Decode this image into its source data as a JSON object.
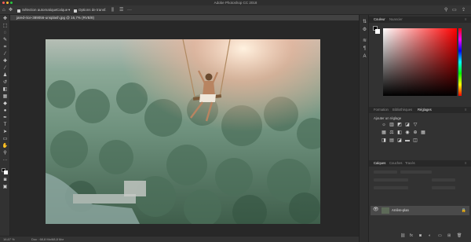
{
  "window": {
    "title": "Adobe Photoshop CC 2018"
  },
  "options_bar": {
    "auto_select_label": "Sélection automatique",
    "auto_select_value": "Calque",
    "transform_label": "Options de transf."
  },
  "document": {
    "tab_title": "jared-rice-389056-unsplash.jpg @ 16,7% (RVB/8)"
  },
  "status_bar": {
    "zoom": "16,67 %",
    "doc_info": "Doc : 68,8 Mo/68,8 Mo"
  },
  "panels": {
    "color_tabs": [
      "Couleur",
      "Nuancier"
    ],
    "adjust_tabs": [
      "Formation",
      "Bibliothèques",
      "Réglages"
    ],
    "adjust_title": "Ajouter un réglage",
    "layers_tabs": [
      "Calques",
      "Couches",
      "Tracés"
    ],
    "layer_name": "Arrière-plan"
  },
  "icons": {
    "move": "move-tool-icon",
    "eye": "eye-icon",
    "lock": "lock-icon"
  },
  "colors": {
    "accent": "#ff0000",
    "panel_bg": "#323232",
    "canvas_bg": "#282828"
  }
}
